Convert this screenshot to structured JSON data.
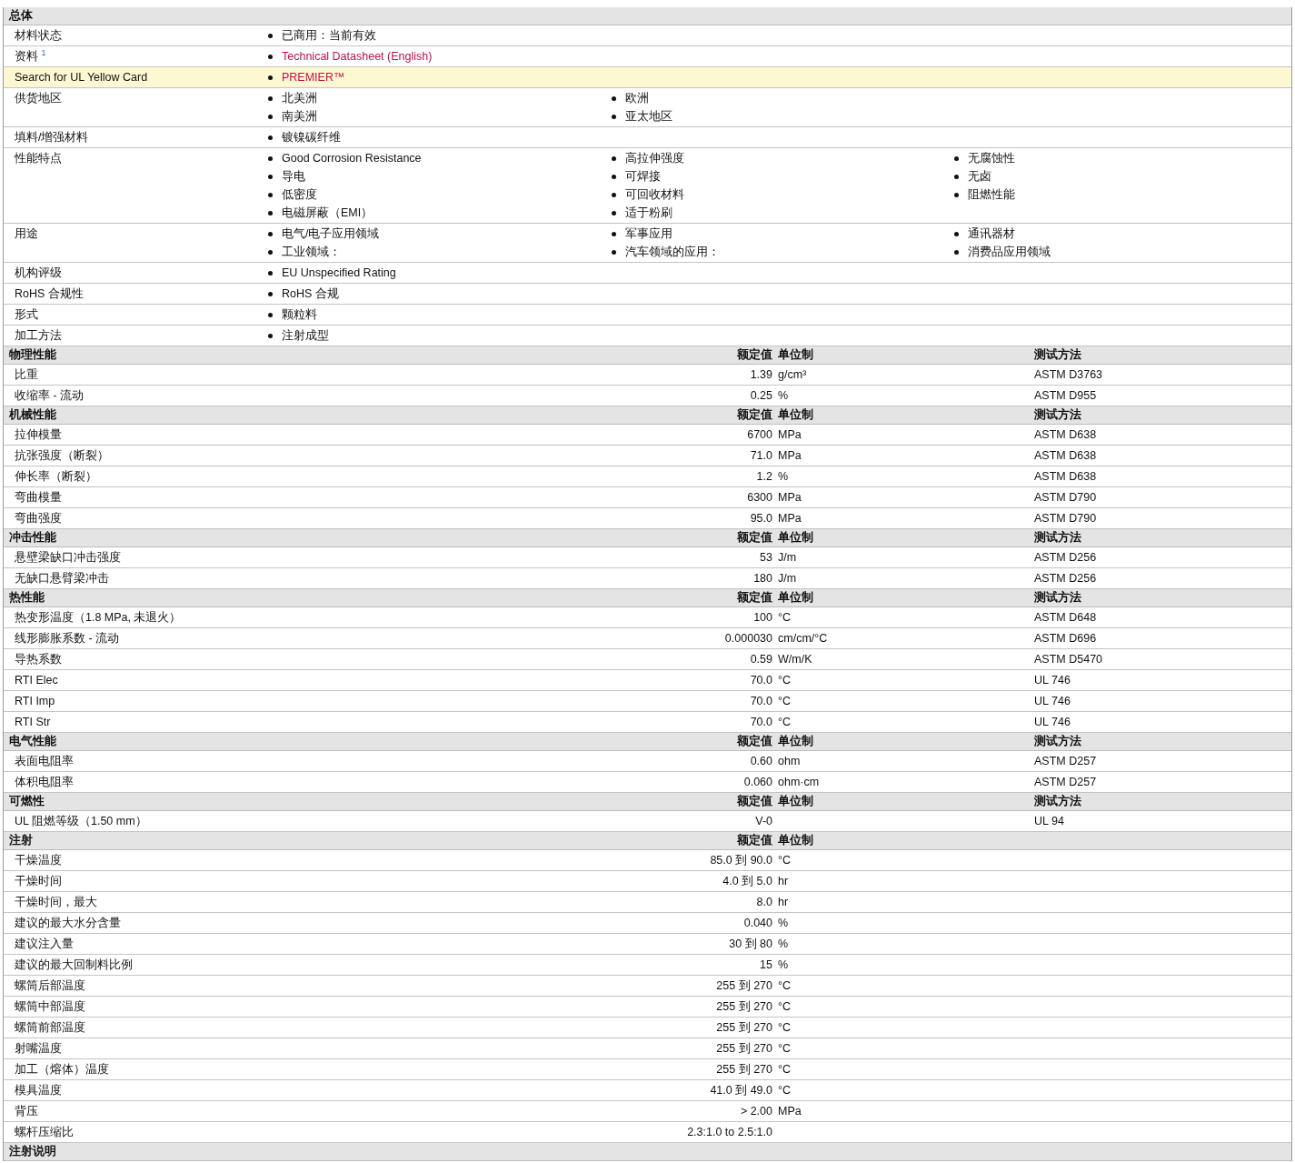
{
  "general": {
    "title": "总体",
    "rows": [
      {
        "label": "材料状态",
        "highlighted": false,
        "columns": [
          [
            {
              "text": "已商用：当前有效",
              "kind": "text"
            }
          ]
        ]
      },
      {
        "label": "资料 $^{1}$",
        "highlighted": false,
        "columns": [
          [
            {
              "text": "Technical Datasheet (English)",
              "kind": "link"
            }
          ]
        ]
      },
      {
        "label": "Search for UL Yellow Card",
        "highlighted": true,
        "columns": [
          [
            {
              "text": "PREMIER™",
              "kind": "link"
            }
          ]
        ]
      },
      {
        "label": "供货地区",
        "highlighted": false,
        "columns": [
          [
            {
              "text": "北美洲",
              "kind": "text"
            },
            {
              "text": "南美洲",
              "kind": "text"
            }
          ],
          [
            {
              "text": "欧洲",
              "kind": "text"
            },
            {
              "text": "亚太地区",
              "kind": "text"
            }
          ]
        ]
      },
      {
        "label": "填料/增强材料",
        "highlighted": false,
        "columns": [
          [
            {
              "text": "镀镍碳纤维",
              "kind": "text"
            }
          ]
        ]
      },
      {
        "label": "性能特点",
        "highlighted": false,
        "columns": [
          [
            {
              "text": "Good Corrosion Resistance",
              "kind": "text"
            },
            {
              "text": "导电",
              "kind": "text"
            },
            {
              "text": "低密度",
              "kind": "text"
            },
            {
              "text": "电磁屏蔽（EMI）",
              "kind": "text"
            }
          ],
          [
            {
              "text": "高拉伸强度",
              "kind": "text"
            },
            {
              "text": "可焊接",
              "kind": "text"
            },
            {
              "text": "可回收材料",
              "kind": "text"
            },
            {
              "text": "适于粉刷",
              "kind": "text"
            }
          ],
          [
            {
              "text": "无腐蚀性",
              "kind": "text"
            },
            {
              "text": "无卤",
              "kind": "text"
            },
            {
              "text": "阻燃性能",
              "kind": "text"
            }
          ]
        ]
      },
      {
        "label": "用途",
        "highlighted": false,
        "columns": [
          [
            {
              "text": "电气/电子应用领域",
              "kind": "text"
            },
            {
              "text": "工业领域：",
              "kind": "text"
            }
          ],
          [
            {
              "text": "军事应用",
              "kind": "text"
            },
            {
              "text": "汽车领域的应用：",
              "kind": "text"
            }
          ],
          [
            {
              "text": "通讯器材",
              "kind": "text"
            },
            {
              "text": "消费品应用领域",
              "kind": "text"
            }
          ]
        ]
      },
      {
        "label": "机构评级",
        "highlighted": false,
        "columns": [
          [
            {
              "text": "EU Unspecified Rating",
              "kind": "text"
            }
          ]
        ]
      },
      {
        "label": "RoHS 合规性",
        "highlighted": false,
        "columns": [
          [
            {
              "text": "RoHS 合规",
              "kind": "text"
            }
          ]
        ]
      },
      {
        "label": "形式",
        "highlighted": false,
        "columns": [
          [
            {
              "text": "颗粒料",
              "kind": "text"
            }
          ]
        ]
      },
      {
        "label": "加工方法",
        "highlighted": false,
        "columns": [
          [
            {
              "text": "注射成型",
              "kind": "text"
            }
          ]
        ]
      }
    ]
  },
  "sections": [
    {
      "title": "物理性能",
      "headers": {
        "value": "额定值",
        "unit": "单位制",
        "method": "测试方法"
      },
      "rows": [
        {
          "label": "比重",
          "value": "1.39",
          "unit": "g/cm³",
          "method": "ASTM D3763"
        },
        {
          "label": "收缩率 - 流动",
          "value": "0.25",
          "unit": "%",
          "method": "ASTM D955"
        }
      ]
    },
    {
      "title": "机械性能",
      "headers": {
        "value": "额定值",
        "unit": "单位制",
        "method": "测试方法"
      },
      "rows": [
        {
          "label": "拉伸模量",
          "value": "6700",
          "unit": "MPa",
          "method": "ASTM D638"
        },
        {
          "label": "抗张强度（断裂）",
          "value": "71.0",
          "unit": "MPa",
          "method": "ASTM D638"
        },
        {
          "label": "伸长率（断裂）",
          "value": "1.2",
          "unit": "%",
          "method": "ASTM D638"
        },
        {
          "label": "弯曲模量",
          "value": "6300",
          "unit": "MPa",
          "method": "ASTM D790"
        },
        {
          "label": "弯曲强度",
          "value": "95.0",
          "unit": "MPa",
          "method": "ASTM D790"
        }
      ]
    },
    {
      "title": "冲击性能",
      "headers": {
        "value": "额定值",
        "unit": "单位制",
        "method": "测试方法"
      },
      "rows": [
        {
          "label": "悬壁梁缺口冲击强度",
          "value": "53",
          "unit": "J/m",
          "method": "ASTM D256"
        },
        {
          "label": "无缺口悬臂梁冲击",
          "value": "180",
          "unit": "J/m",
          "method": "ASTM D256"
        }
      ]
    },
    {
      "title": "热性能",
      "headers": {
        "value": "额定值",
        "unit": "单位制",
        "method": "测试方法"
      },
      "rows": [
        {
          "label": "热变形温度（1.8 MPa, 未退火）",
          "value": "100",
          "unit": "°C",
          "method": "ASTM D648"
        },
        {
          "label": "线形膨胀系数 - 流动",
          "value": "0.000030",
          "unit": "cm/cm/°C",
          "method": "ASTM D696"
        },
        {
          "label": "导热系数",
          "value": "0.59",
          "unit": "W/m/K",
          "method": "ASTM D5470"
        },
        {
          "label": "RTI Elec",
          "value": "70.0",
          "unit": "°C",
          "method": "UL 746"
        },
        {
          "label": "RTI Imp",
          "value": "70.0",
          "unit": "°C",
          "method": "UL 746"
        },
        {
          "label": "RTI Str",
          "value": "70.0",
          "unit": "°C",
          "method": "UL 746"
        }
      ]
    },
    {
      "title": "电气性能",
      "headers": {
        "value": "额定值",
        "unit": "单位制",
        "method": "测试方法"
      },
      "rows": [
        {
          "label": "表面电阻率",
          "value": "0.60",
          "unit": "ohm",
          "method": "ASTM D257"
        },
        {
          "label": "体积电阻率",
          "value": "0.060",
          "unit": "ohm·cm",
          "method": "ASTM D257"
        }
      ]
    },
    {
      "title": "可燃性",
      "headers": {
        "value": "额定值",
        "unit": "单位制",
        "method": "测试方法"
      },
      "rows": [
        {
          "label": "UL 阻燃等级（1.50 mm）",
          "value": "V-0",
          "method": "UL 94"
        }
      ]
    },
    {
      "title": "注射",
      "headers": {
        "value": "额定值",
        "unit": "单位制"
      },
      "rows": [
        {
          "label": "干燥温度",
          "value": "85.0 到 90.0",
          "unit": "°C"
        },
        {
          "label": "干燥时间",
          "value": "4.0 到 5.0",
          "unit": "hr"
        },
        {
          "label": "干燥时间，最大",
          "value": "8.0",
          "unit": "hr"
        },
        {
          "label": "建议的最大水分含量",
          "value": "0.040",
          "unit": "%"
        },
        {
          "label": "建议注入量",
          "value": "30 到 80",
          "unit": "%"
        },
        {
          "label": "建议的最大回制料比例",
          "value": "15",
          "unit": "%"
        },
        {
          "label": "螺筒后部温度",
          "value": "255 到 270",
          "unit": "°C"
        },
        {
          "label": "螺筒中部温度",
          "value": "255 到 270",
          "unit": "°C"
        },
        {
          "label": "螺筒前部温度",
          "value": "255 到 270",
          "unit": "°C"
        },
        {
          "label": "射嘴温度",
          "value": "255 到 270",
          "unit": "°C"
        },
        {
          "label": "加工（熔体）温度",
          "value": "255 到 270",
          "unit": "°C"
        },
        {
          "label": "模具温度",
          "value": "41.0 到 49.0",
          "unit": "°C"
        },
        {
          "label": "背压",
          "value": "> 2.00",
          "unit": "MPa"
        },
        {
          "label": "螺杆压缩比",
          "value": "2.3:1.0 to 2.5:1.0"
        }
      ]
    },
    {
      "title": "注射说明"
    }
  ]
}
